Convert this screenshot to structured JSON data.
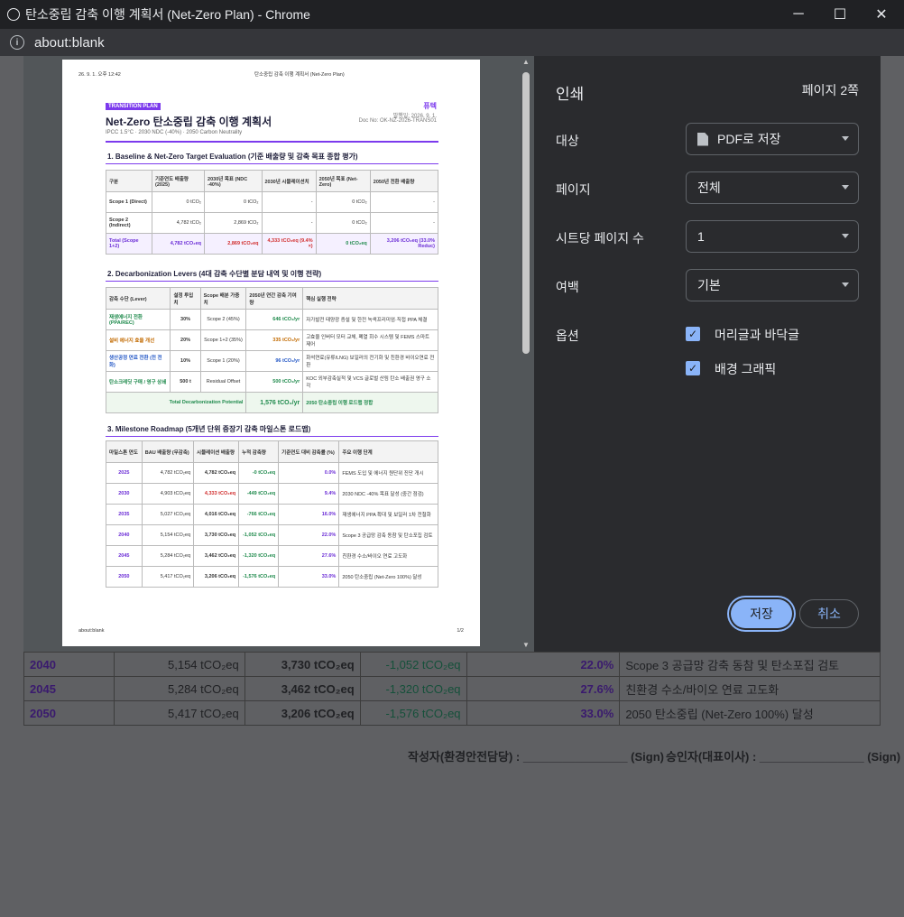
{
  "window": {
    "title": "탄소중립 감축 이행 계획서 (Net-Zero Plan) - Chrome",
    "minimize": "─",
    "maximize": "☐",
    "close": "✕"
  },
  "address": {
    "info": "i",
    "url": "about:blank"
  },
  "preview": {
    "header_date": "26. 9. 1. 오후 12:42",
    "header_title": "탄소중립 감축 이행 계획서 (Net-Zero Plan)",
    "tag": "TRANSITION PLAN",
    "title": "Net-Zero 탄소중립 감축 이행 계획서",
    "subtitle": "IPCC 1.5°C · 2030 NDC (-40%) · 2050 Carbon Neutrality",
    "company": "퓨텍",
    "issue_date": "발행일: 2026. 9. 1.",
    "doc_no": "Doc No: OK-NZ-2026-TRANS01",
    "section1": "1. Baseline & Net-Zero Target Evaluation (기준 배출량 및 감축 목표 종합 평가)",
    "t1_headers": [
      "구분",
      "기준연도 배출량 (2025)",
      "2030년 목표 (NDC -40%)",
      "2030년 시뮬레이션치",
      "2050년 목표 (Net-Zero)",
      "2050년 전환 배출량"
    ],
    "t1_rows": [
      [
        "Scope 1 (Direct)",
        "0 tCO₂",
        "0 tCO₂",
        "-",
        "0 tCO₂",
        "-"
      ],
      [
        "Scope 2 (Indirect)",
        "4,782 tCO₂",
        "2,869 tCO₂",
        "-",
        "0 tCO₂",
        "-"
      ]
    ],
    "t1_total": [
      "Total (Scope 1+2)",
      "4,782 tCO₂eq",
      "2,869 tCO₂eq",
      "4,333 tCO₂eq (9.4% ×)",
      "0 tCO₂eq",
      "3,206 tCO₂eq (33.0% Reduc)"
    ],
    "section2": "2. Decarbonization Levers (4대 감축 수단별 분담 내역 및 이행 전략)",
    "t2_headers": [
      "감축 수단 (Lever)",
      "설정 투입치",
      "Scope 배분 가중치",
      "2050년 연간 감축 기여량",
      "핵심 실행 전략"
    ],
    "t2_rows": [
      [
        "재생에너지 전환 (PPA/REC)",
        "30%",
        "Scope 2 (45%)",
        "646 tCO₂/yr",
        "자가발전 태양광 증설 및 한전 녹색프리미엄·직접 PPA 체결"
      ],
      [
        "설비 에너지 효율 개선",
        "20%",
        "Scope 1+2 (35%)",
        "335 tCO₂/yr",
        "고효율 인버터 모터 교체, 폐열 회수 시스템 및 FEMS 스마트 제어"
      ],
      [
        "생산공정 연료 전환 (전 전화)",
        "10%",
        "Scope 1 (20%)",
        "96 tCO₂/yr",
        "화석연료(유류/LNG) 보일러의 전기화 및 친환경 바이오연료 전환"
      ],
      [
        "탄소크레딧 구매 / 영구 상쇄",
        "500 t",
        "Residual Offset",
        "500 tCO₂/yr",
        "KOC 외부감축실적 및 VCS 글로벌 산림 탄소 배출권 영구 소각"
      ]
    ],
    "t2_total_label": "Total Decarbonization Potential",
    "t2_total_value": "1,576 tCO₂/yr",
    "t2_total_note": "2050 탄소중립 이행 로드맵 정합",
    "section3": "3. Milestone Roadmap (5개년 단위 중장기 감축 마일스톤 로드맵)",
    "t3_headers": [
      "마일스톤 연도",
      "BAU 배출량 (무감축)",
      "시뮬레이션 배출량",
      "누적 감축량",
      "기준연도 대비 감축률 (%)",
      "주요 이행 단계"
    ],
    "t3_rows": [
      [
        "2025",
        "4,782 tCO₂eq",
        "4,782 tCO₂eq",
        "-0 tCO₂eq",
        "0.0%",
        "FEMS 도입 및 에너지 원단위 진단 개시"
      ],
      [
        "2030",
        "4,903 tCO₂eq",
        "4,333 tCO₂eq",
        "-449 tCO₂eq",
        "9.4%",
        "2030 NDC -40% 목표 달성 (중간 점검)"
      ],
      [
        "2035",
        "5,027 tCO₂eq",
        "4,016 tCO₂eq",
        "-766 tCO₂eq",
        "16.0%",
        "재생에너지 PPA 확대 및 보일러 1차 전철화"
      ],
      [
        "2040",
        "5,154 tCO₂eq",
        "3,730 tCO₂eq",
        "-1,052 tCO₂eq",
        "22.0%",
        "Scope 3 공급망 감축 동참 및 탄소포집 검토"
      ],
      [
        "2045",
        "5,284 tCO₂eq",
        "3,462 tCO₂eq",
        "-1,320 tCO₂eq",
        "27.6%",
        "친환경 수소/바이오 연료 고도화"
      ],
      [
        "2050",
        "5,417 tCO₂eq",
        "3,206 tCO₂eq",
        "-1,576 tCO₂eq",
        "33.0%",
        "2050 탄소중립 (Net-Zero 100%) 달성"
      ]
    ],
    "footer_left": "about:blank",
    "footer_right": "1/2"
  },
  "background": {
    "rows": [
      [
        "2040",
        "5,154 tCO₂eq",
        "3,730 tCO₂eq",
        "-1,052 tCO₂eq",
        "22.0%",
        "Scope 3 공급망 감축 동참 및 탄소포집 검토"
      ],
      [
        "2045",
        "5,284 tCO₂eq",
        "3,462 tCO₂eq",
        "-1,320 tCO₂eq",
        "27.6%",
        "친환경 수소/바이오 연료 고도화"
      ],
      [
        "2050",
        "5,417 tCO₂eq",
        "3,206 tCO₂eq",
        "-1,576 tCO₂eq",
        "33.0%",
        "2050 탄소중립 (Net-Zero 100%) 달성"
      ]
    ],
    "sign_writer": "작성자(환경안전담당) : ________________ (Sign)",
    "sign_approver": "승인자(대표이사) : ________________ (Sign)"
  },
  "print": {
    "heading": "인쇄",
    "page_count": "페이지 2쪽",
    "destination_label": "대상",
    "destination_value": "PDF로 저장",
    "pages_label": "페이지",
    "pages_value": "전체",
    "per_sheet_label": "시트당 페이지 수",
    "per_sheet_value": "1",
    "margins_label": "여백",
    "margins_value": "기본",
    "options_label": "옵션",
    "opt_headers": "머리글과 바닥글",
    "opt_background": "배경 그래픽",
    "save": "저장",
    "cancel": "취소"
  }
}
